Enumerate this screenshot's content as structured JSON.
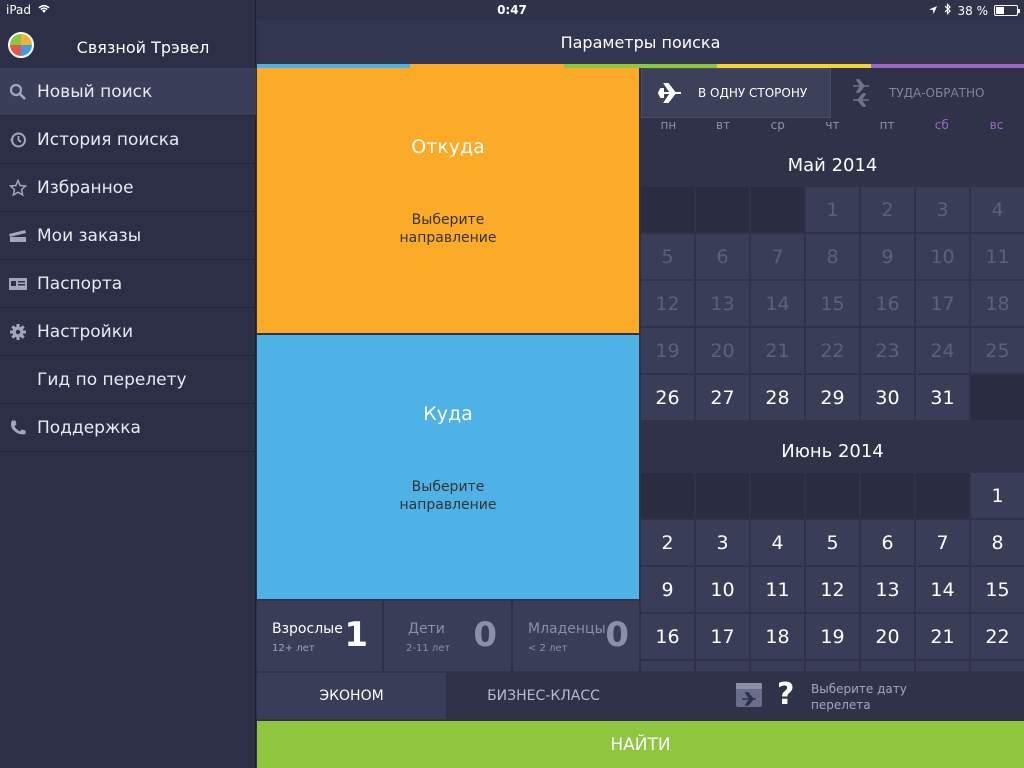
{
  "status": {
    "device": "iPad",
    "time": "0:47",
    "battery": "38 %",
    "battery_level": 0.38
  },
  "sidebar": {
    "title": "Связной Трэвел",
    "items": [
      {
        "label": "Новый поиск",
        "icon": "search-icon"
      },
      {
        "label": "История поиска",
        "icon": "history-icon"
      },
      {
        "label": "Избранное",
        "icon": "star-icon"
      },
      {
        "label": "Мои заказы",
        "icon": "ticket-icon"
      },
      {
        "label": "Паспорта",
        "icon": "id-card-icon"
      },
      {
        "label": "Настройки",
        "icon": "gear-icon"
      },
      {
        "label": "Гид по перелету",
        "icon": ""
      },
      {
        "label": "Поддержка",
        "icon": "phone-icon"
      }
    ]
  },
  "main": {
    "title": "Параметры поиска",
    "colors": [
      "#4fb2e6",
      "#fbab28",
      "#8ec640",
      "#f0d23c",
      "#9b6bc4"
    ],
    "from": {
      "title": "Откуда",
      "sub": "Выберите направление"
    },
    "to": {
      "title": "Куда",
      "sub": "Выберите направление"
    },
    "pax": [
      {
        "label": "Взрослые",
        "sub": "12+ лет",
        "count": "1"
      },
      {
        "label": "Дети",
        "sub": "2-11 лет",
        "count": "0"
      },
      {
        "label": "Младенцы",
        "sub": "< 2 лет",
        "count": "0"
      }
    ],
    "classes": {
      "economy": "ЭКОНОМ",
      "business": "БИЗНЕС-КЛАСС"
    },
    "find": "НАЙТИ"
  },
  "calendar": {
    "one_way": "В ОДНУ СТОРОНУ",
    "round_trip": "ТУДА-ОБРАТНО",
    "weekdays": [
      "пн",
      "вт",
      "ср",
      "чт",
      "пт",
      "сб",
      "вс"
    ],
    "may_title": "Май 2014",
    "june_title": "Июнь 2014",
    "date_hint": "Выберите дату перелета"
  }
}
